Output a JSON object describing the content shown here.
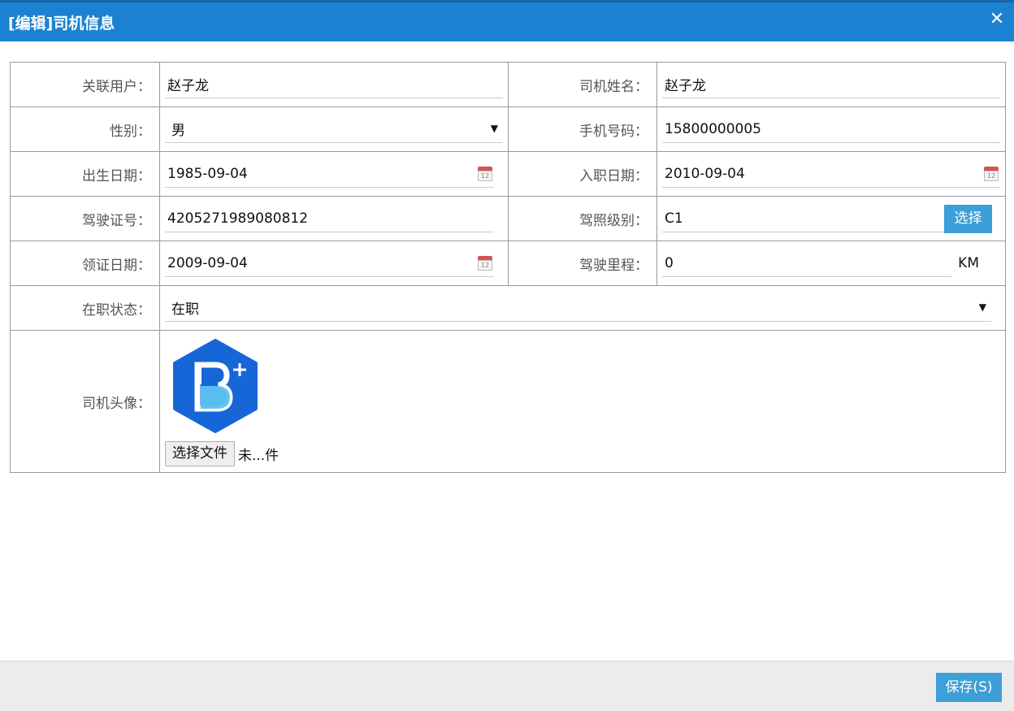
{
  "dialog": {
    "title": "[编辑]司机信息",
    "close_glyph": "✕"
  },
  "form": {
    "linked_user": {
      "label": "关联用户：",
      "value": "赵子龙"
    },
    "driver_name": {
      "label": "司机姓名：",
      "value": "赵子龙"
    },
    "gender": {
      "label": "性别：",
      "value": "男"
    },
    "phone": {
      "label": "手机号码：",
      "value": "15800000005"
    },
    "birth_date": {
      "label": "出生日期：",
      "value": "1985-09-04"
    },
    "hire_date": {
      "label": "入职日期：",
      "value": "2010-09-04"
    },
    "license_no": {
      "label": "驾驶证号：",
      "value": "4205271989080812"
    },
    "license_class": {
      "label": "驾照级别：",
      "value": "C1",
      "button": "选择"
    },
    "issue_date": {
      "label": "领证日期：",
      "value": "2009-09-04"
    },
    "mileage": {
      "label": "驾驶里程：",
      "value": "0",
      "unit": "KM"
    },
    "status": {
      "label": "在职状态：",
      "value": "在职"
    },
    "avatar": {
      "label": "司机头像：",
      "file_button": "选择文件",
      "file_text": "未...件"
    }
  },
  "icons": {
    "dropdown": "chevron-down-icon",
    "calendar": "calendar-icon",
    "calendar_day": "12"
  },
  "footer": {
    "save_label": "保存(S)"
  },
  "colors": {
    "titlebar": "#1b82d1",
    "accent_button": "#3d9fd8",
    "footer_bg": "#ececec"
  }
}
